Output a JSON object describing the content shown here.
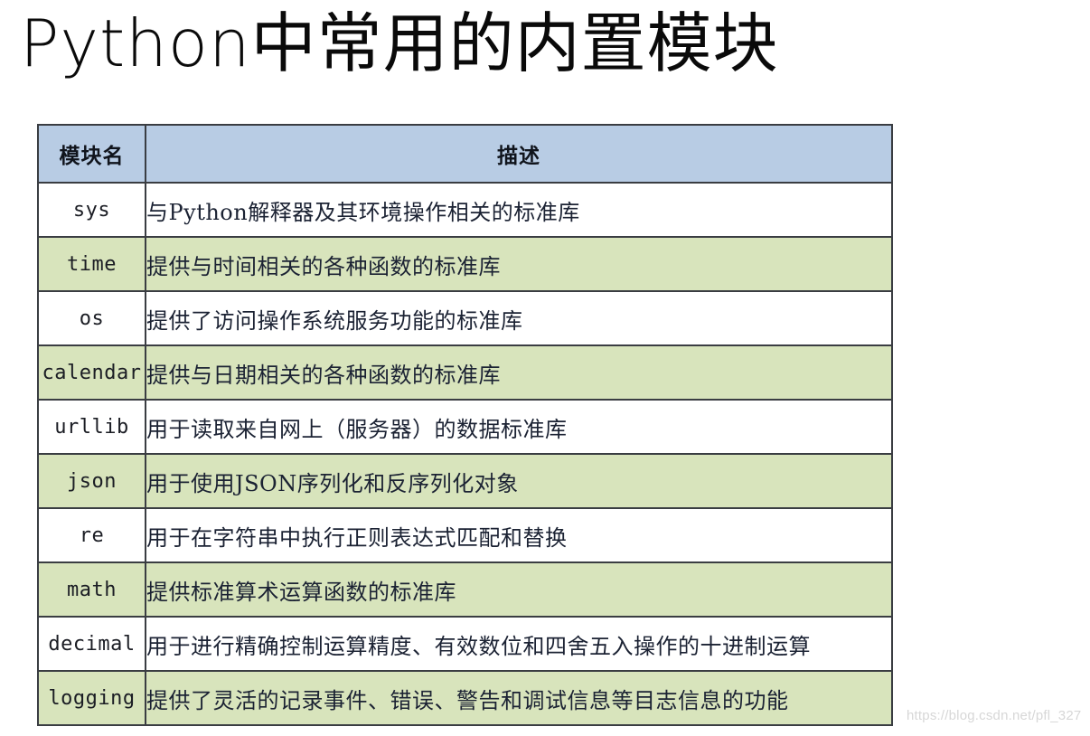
{
  "page": {
    "title": "Python中常用的内置模块",
    "background_color": "#ffffff",
    "watermark": "https://blog.csdn.net/pfl_327"
  },
  "table": {
    "header_bg": "#b8cce4",
    "stripe_bg": "#d8e4bc",
    "plain_bg": "#ffffff",
    "border_color": "#3a3d42",
    "columns": [
      {
        "key": "name",
        "label": "模块名"
      },
      {
        "key": "desc",
        "label": "描述"
      }
    ],
    "rows": [
      {
        "name": "sys",
        "desc": "与Python解释器及其环境操作相关的标准库",
        "stripe": false
      },
      {
        "name": "time",
        "desc": "提供与时间相关的各种函数的标准库",
        "stripe": true
      },
      {
        "name": "os",
        "desc": "提供了访问操作系统服务功能的标准库",
        "stripe": false
      },
      {
        "name": "calendar",
        "desc": "提供与日期相关的各种函数的标准库",
        "stripe": true
      },
      {
        "name": "urllib",
        "desc": "用于读取来自网上（服务器）的数据标准库",
        "stripe": false
      },
      {
        "name": "json",
        "desc": "用于使用JSON序列化和反序列化对象",
        "stripe": true
      },
      {
        "name": "re",
        "desc": "用于在字符串中执行正则表达式匹配和替换",
        "stripe": false
      },
      {
        "name": "math",
        "desc": "提供标准算术运算函数的标准库",
        "stripe": true
      },
      {
        "name": "decimal",
        "desc": "用于进行精确控制运算精度、有效数位和四舍五入操作的十进制运算",
        "stripe": false
      },
      {
        "name": "logging",
        "desc": "提供了灵活的记录事件、错误、警告和调试信息等目志信息的功能",
        "stripe": true
      }
    ]
  }
}
